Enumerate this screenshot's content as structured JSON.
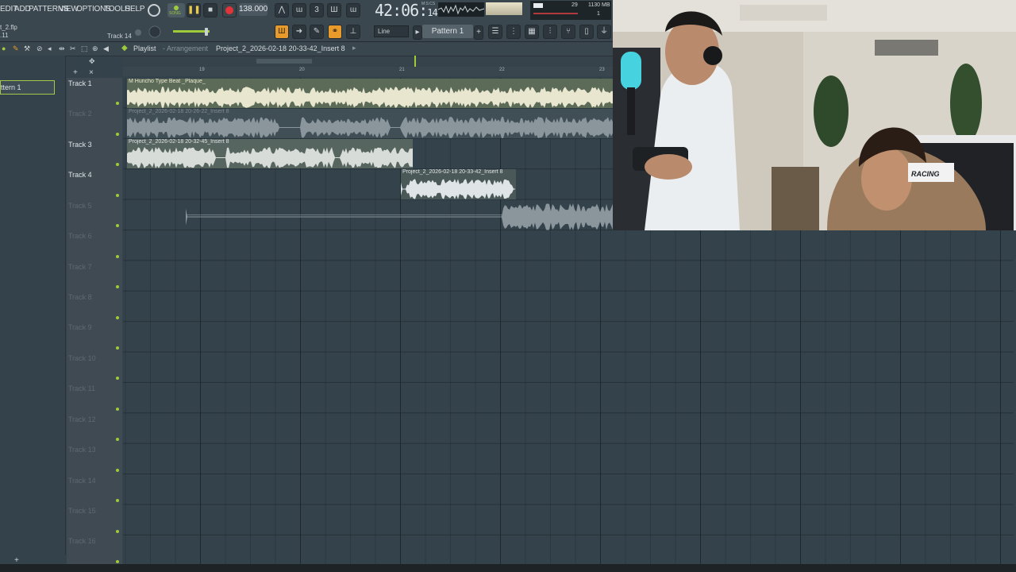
{
  "menu": {
    "items": [
      "EDIT",
      "ADD",
      "PATTERNS",
      "VIEW",
      "OPTIONS",
      "TOOLS",
      "HELP"
    ]
  },
  "transport": {
    "song_label": "SONG",
    "tempo": "138.000",
    "time_main": "42:06",
    "time_small": "14",
    "time_unit": "M:S:CS"
  },
  "cpu": {
    "value1": "29",
    "memory": "1130 MB",
    "value2": "1"
  },
  "project": {
    "filename": "t_2.flp",
    "hint": ".11",
    "target_track": "Track 14"
  },
  "toolbar": {
    "snap": "Line",
    "pattern": "Pattern 1"
  },
  "playlist": {
    "title": "Playlist",
    "separator": "- Arrangement",
    "clip_name": "Project_2_2026-02-18 20-33-42_Insert 8"
  },
  "picker": {
    "selected": "ttern 1"
  },
  "ruler": {
    "bars": [
      "19",
      "20",
      "21",
      "22",
      "23"
    ]
  },
  "tracks": [
    {
      "name": "Track 1",
      "active": true
    },
    {
      "name": "Track 2",
      "active": false
    },
    {
      "name": "Track 3",
      "active": true
    },
    {
      "name": "Track 4",
      "active": true
    },
    {
      "name": "Track 5",
      "active": false
    },
    {
      "name": "Track 6",
      "active": false
    },
    {
      "name": "Track 7",
      "active": false
    },
    {
      "name": "Track 8",
      "active": false
    },
    {
      "name": "Track 9",
      "active": false
    },
    {
      "name": "Track 10",
      "active": false
    },
    {
      "name": "Track 11",
      "active": false
    },
    {
      "name": "Track 12",
      "active": false
    },
    {
      "name": "Track 13",
      "active": false
    },
    {
      "name": "Track 14",
      "active": false
    },
    {
      "name": "Track 15",
      "active": false
    },
    {
      "name": "Track 16",
      "active": false
    }
  ],
  "clips": {
    "c1": "M Huncho Type Beat _Plaque_",
    "c2": "Project_2_2026-02-18 20-26-22_Insert 8",
    "c3": "Project_2_2026-02-18 20-32-45_Insert 8",
    "c4": "Project_2_2026-02-18 20-33-42_Insert 8"
  },
  "webcam": {
    "chair_brand": "RACING"
  },
  "colors": {
    "accent_green": "#9ecb3a",
    "record_red": "#e0333a",
    "background": "#34424b"
  },
  "icons": [
    "record-icon",
    "play-pause-icon",
    "stop-icon",
    "link-icon",
    "microphone-icon",
    "pencil-icon"
  ]
}
